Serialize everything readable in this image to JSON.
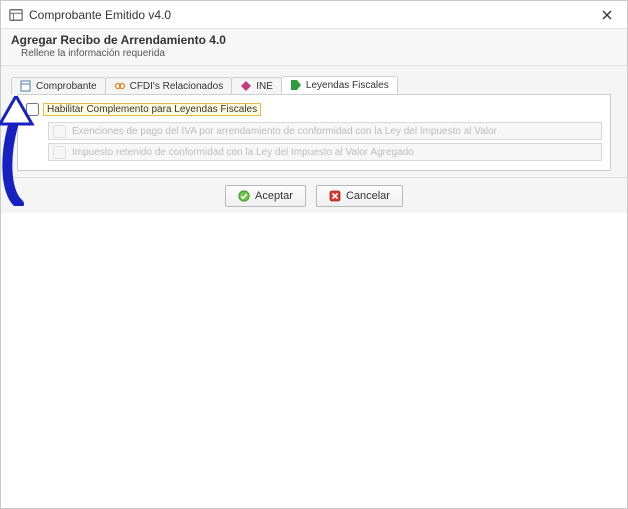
{
  "titlebar": {
    "title": "Comprobante Emitido v4.0"
  },
  "header": {
    "title": "Agregar Recibo de Arrendamiento 4.0",
    "subtitle": "Rellene la información requerida"
  },
  "tabs": [
    {
      "label": "Comprobante"
    },
    {
      "label": "CFDI's Relacionados"
    },
    {
      "label": "INE"
    },
    {
      "label": "Leyendas Fiscales"
    }
  ],
  "group": {
    "enable_label": "Habilitar Complemento para Leyendas Fiscales",
    "rows": [
      {
        "text": "Exenciones de pago del IVA por arrendamiento de conformidad con la Ley del Impuesto al Valor"
      },
      {
        "text": "Impuesto retenido de conformidad con la Ley del Impuesto al Valor Agregado"
      }
    ]
  },
  "footer": {
    "accept": "Aceptar",
    "cancel": "Cancelar"
  }
}
